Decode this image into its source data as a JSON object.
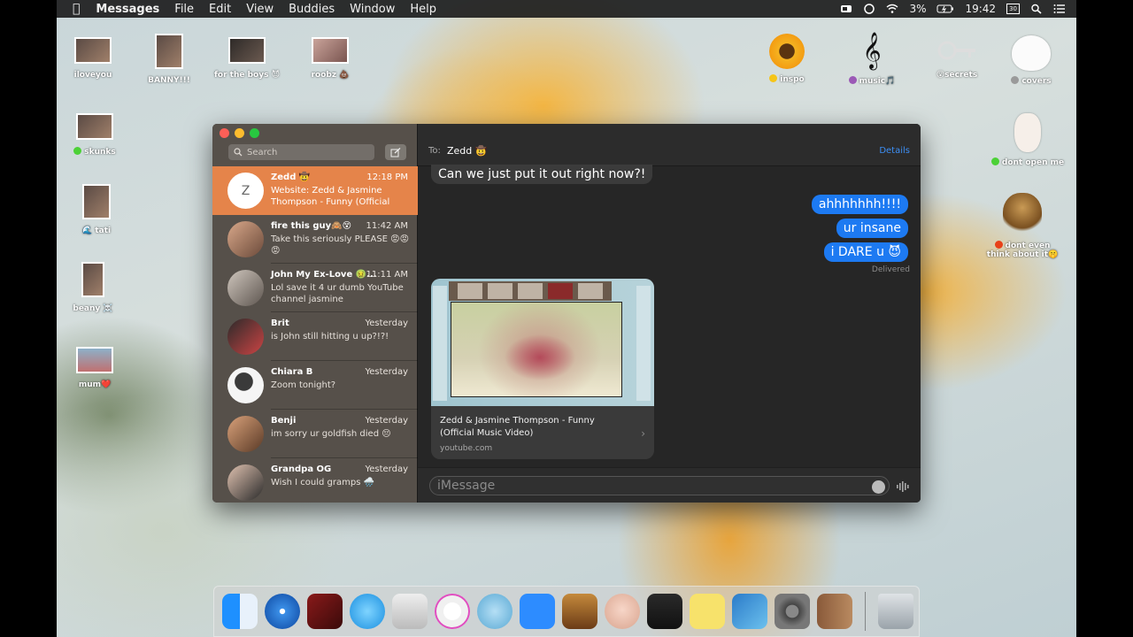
{
  "menubar": {
    "app_name": "Messages",
    "menus": [
      "File",
      "Edit",
      "View",
      "Buddies",
      "Window",
      "Help"
    ],
    "battery": "3%",
    "clock": "19:42",
    "date_badge": "30"
  },
  "desktop": {
    "items": [
      {
        "label": "iloveyou",
        "icon": "photo-thumbnail"
      },
      {
        "label": "BANNY!!!",
        "icon": "photo-thumbnail"
      },
      {
        "label": "for the boys 😈",
        "icon": "photo-thumbnail"
      },
      {
        "label": "roobz 💩",
        "icon": "photo-thumbnail"
      },
      {
        "label": "skunks",
        "icon": "photo-thumbnail",
        "tag": "green"
      },
      {
        "label": "🌊 tati",
        "icon": "photo-thumbnail"
      },
      {
        "label": "beany ☠️",
        "icon": "photo-thumbnail"
      },
      {
        "label": "mum❤️",
        "icon": "photo-thumbnail"
      },
      {
        "label": "inspo",
        "icon": "sunflower-folder-icon",
        "tag": "yellow"
      },
      {
        "label": "music🎵",
        "icon": "treble-clef-folder-icon",
        "tag": "purple"
      },
      {
        "label": "😮secrets",
        "icon": "key-folder-icon"
      },
      {
        "label": "covers",
        "icon": "bunny-folder-icon",
        "tag": "gray"
      },
      {
        "label": "dont open me",
        "icon": "bunny-bow-folder-icon",
        "tag": "green"
      },
      {
        "label": "dont even",
        "label2": "think about it🤫",
        "icon": "lion-folder-icon",
        "tag": "red"
      }
    ]
  },
  "messages_window": {
    "search_placeholder": "Search",
    "conversations": [
      {
        "name": "Zedd 🤠",
        "time": "12:18 PM",
        "preview": "Website: Zedd & Jasmine Thompson - Funny (Official Mu...",
        "initial": "Z",
        "selected": true
      },
      {
        "name": "fire this guy🙈😵",
        "time": "11:42 AM",
        "preview": "Take this seriously PLEASE 😡😡😡"
      },
      {
        "name": "John My Ex-Love 🤢...",
        "time": "11:11 AM",
        "preview": "Lol save it 4 ur dumb YouTube channel jasmine"
      },
      {
        "name": "Brit",
        "time": "Yesterday",
        "preview": "is John still hitting u up?!?!"
      },
      {
        "name": "Chiara B",
        "time": "Yesterday",
        "preview": "Zoom tonight?"
      },
      {
        "name": "Benji",
        "time": "Yesterday",
        "preview": "im sorry ur goldfish died 😔"
      },
      {
        "name": "Grandpa OG",
        "time": "Yesterday",
        "preview": "Wish I could gramps 🌧️"
      }
    ],
    "chat": {
      "to_label": "To:",
      "recipient": "Zedd 🤠",
      "details_label": "Details",
      "incoming_message": "Can we just put it out right now?!",
      "outgoing_messages": [
        "ahhhhhhh!!!!",
        "ur insane",
        "i DARE u 😈"
      ],
      "delivered_label": "Delivered",
      "link_preview": {
        "title": "Zedd & Jasmine Thompson - Funny (Official Music Video)",
        "domain": "youtube.com"
      },
      "input_placeholder": "iMessage"
    }
  },
  "dock": {
    "apps": [
      "finder-icon",
      "safari-icon",
      "photo-booth-icon",
      "messages-icon",
      "sketch-icon",
      "itunes-icon",
      "seal-icon",
      "zoom-icon",
      "garageband-icon",
      "memoji-icon",
      "voice-memo-icon",
      "stickies-icon",
      "preview-icon",
      "system-preferences-icon",
      "contacts-icon",
      "trash-icon"
    ]
  },
  "colors": {
    "selected_row": "#e5844a",
    "outgoing_bubble": "#1d7af2",
    "details_link": "#3d8ff5"
  }
}
